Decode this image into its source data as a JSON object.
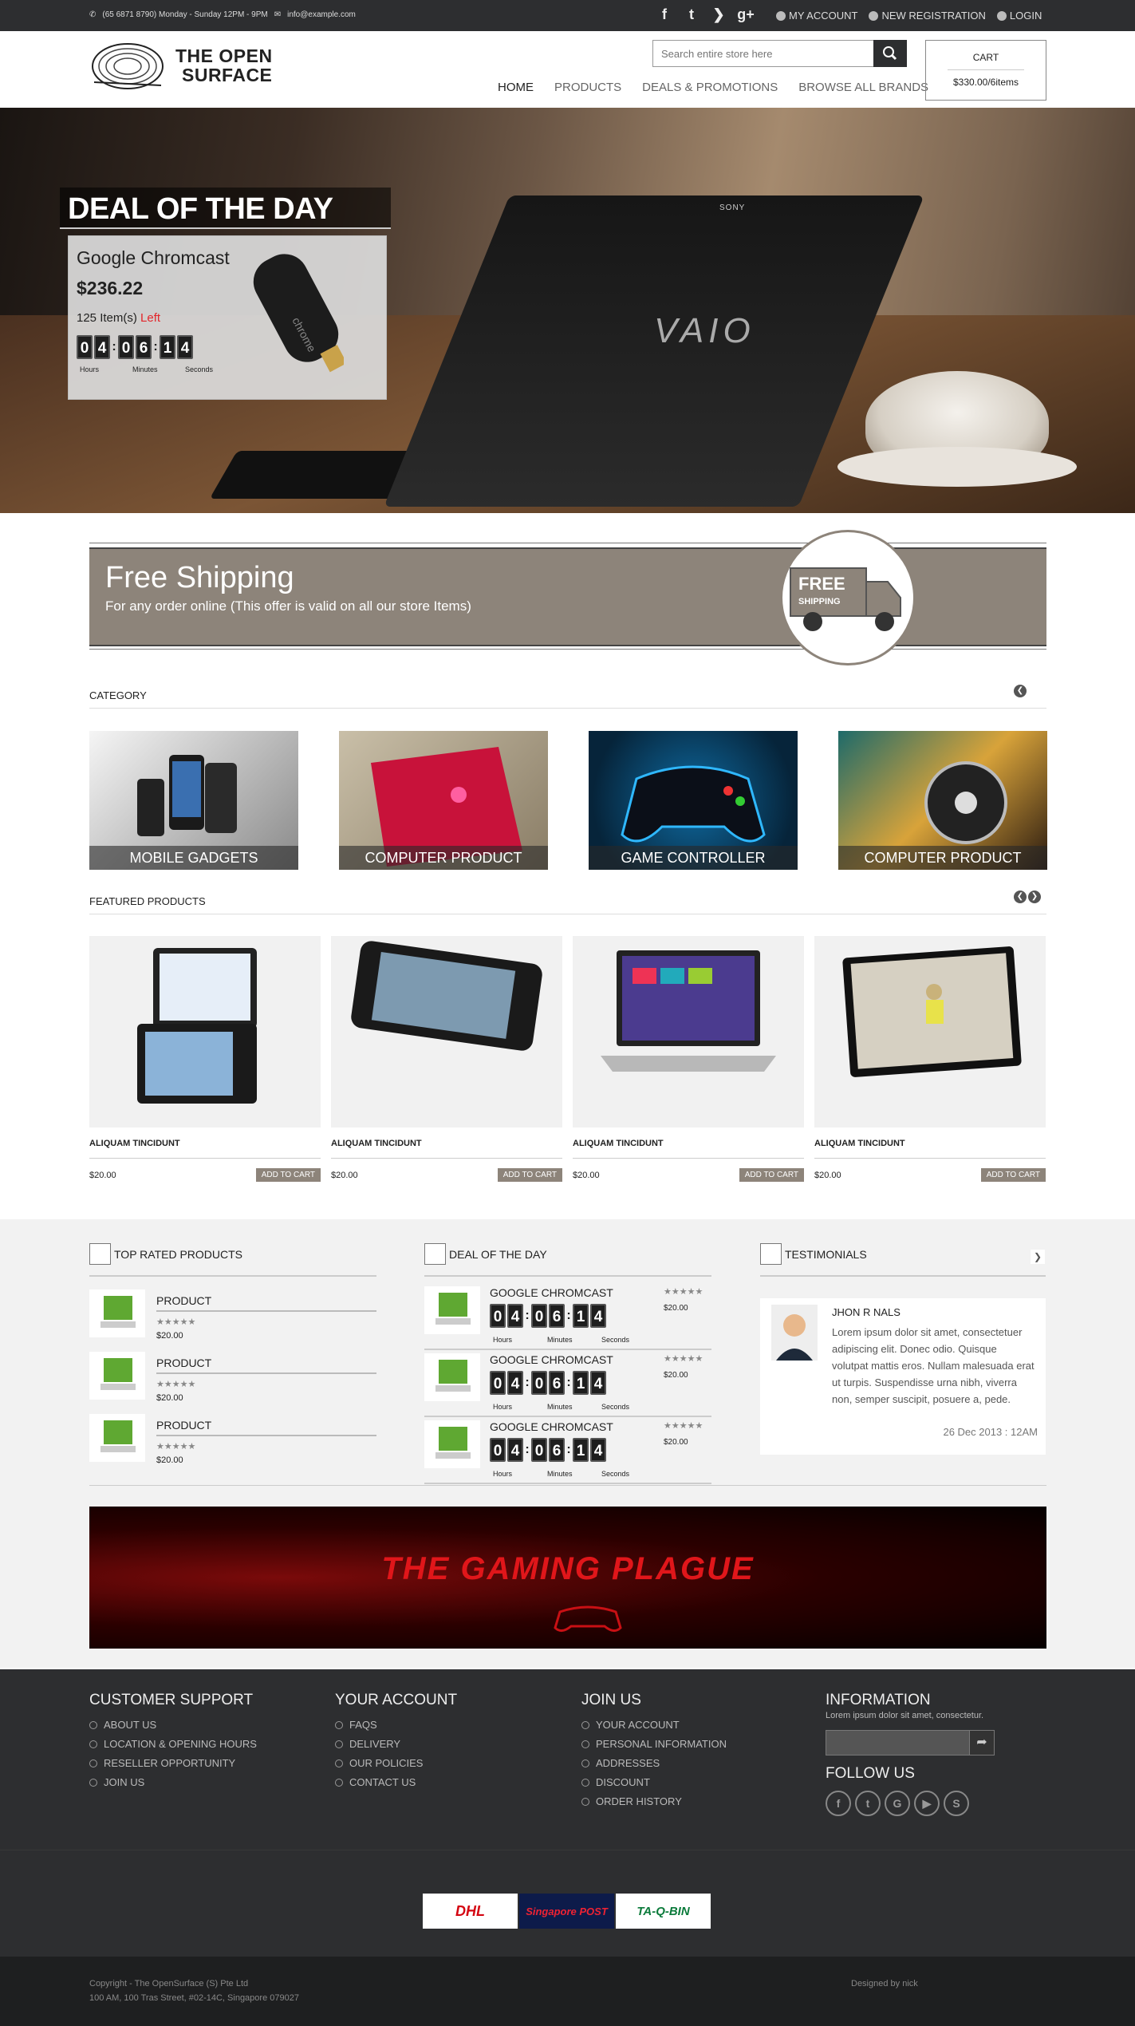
{
  "topbar": {
    "phone": "(65 6871 8790) Monday - Sunday 12PM - 9PM",
    "email": "info@example.com",
    "links": [
      "MY ACCOUNT",
      "NEW REGISTRATION",
      "LOGIN"
    ]
  },
  "header": {
    "logo_line1": "THE OPEN",
    "logo_line2": "SURFACE",
    "search_placeholder": "Search entire store here",
    "nav": [
      "HOME",
      "PRODUCTS",
      "DEALS & PROMOTIONS",
      "BROWSE ALL BRANDS"
    ],
    "cart_label": "CART",
    "cart_total": "$330.00/6items"
  },
  "hero": {
    "brand_top": "SONY",
    "brand_main": "VAIO",
    "deal_title": "DEAL OF THE DAY",
    "product": "Google Chromcast",
    "price": "$236.22",
    "items_count": "125 Item(s)",
    "items_left": "Left",
    "digits": [
      "0",
      "4",
      "0",
      "6",
      "1",
      "4"
    ],
    "labels": [
      "Hours",
      "Minutes",
      "Seconds"
    ]
  },
  "shipping": {
    "title": "Free Shipping",
    "subtitle": "For any order online (This offer is valid on all our store Items)",
    "badge1": "FREE",
    "badge2": "SHIPPING"
  },
  "category": {
    "heading": "CATEGORY",
    "items": [
      "MOBILE GADGETS",
      "COMPUTER PRODUCT",
      "GAME CONTROLLER",
      "COMPUTER PRODUCT"
    ]
  },
  "featured": {
    "heading": "FEATURED PRODUCTS",
    "items": [
      {
        "name": "ALIQUAM TINCIDUNT",
        "price": "$20.00",
        "btn": "ADD TO CART"
      },
      {
        "name": "ALIQUAM TINCIDUNT",
        "price": "$20.00",
        "btn": "ADD TO CART"
      },
      {
        "name": "ALIQUAM TINCIDUNT",
        "price": "$20.00",
        "btn": "ADD TO CART"
      },
      {
        "name": "ALIQUAM TINCIDUNT",
        "price": "$20.00",
        "btn": "ADD TO CART"
      }
    ]
  },
  "top_rated": {
    "heading": "TOP RATED PRODUCTS",
    "items": [
      {
        "name": "PRODUCT",
        "stars": "★★★★★",
        "price": "$20.00"
      },
      {
        "name": "PRODUCT",
        "stars": "★★★★★",
        "price": "$20.00"
      },
      {
        "name": "PRODUCT",
        "stars": "★★★★★",
        "price": "$20.00"
      }
    ]
  },
  "deal_list": {
    "heading": "DEAL OF THE DAY",
    "items": [
      {
        "name": "GOOGLE CHROMCAST",
        "stars": "★★★★★",
        "price": "$20.00"
      },
      {
        "name": "GOOGLE CHROMCAST",
        "stars": "★★★★★",
        "price": "$20.00"
      },
      {
        "name": "GOOGLE CHROMCAST",
        "stars": "★★★★★",
        "price": "$20.00"
      }
    ]
  },
  "testimonials": {
    "heading": "TESTIMONIALS",
    "name": "JHON R NALS",
    "text": "Lorem ipsum dolor sit amet, consectetuer adipiscing elit. Donec odio. Quisque volutpat mattis eros. Nullam malesuada erat ut turpis. Suspendisse urna nibh, viverra non, semper suscipit, posuere a, pede.",
    "date": "26 Dec 2013 : 12AM"
  },
  "banner": {
    "title": "THE GAMING PLAGUE"
  },
  "footer": {
    "customer_support": {
      "heading": "CUSTOMER SUPPORT",
      "items": [
        "ABOUT US",
        "LOCATION & OPENING HOURS",
        "RESELLER OPPORTUNITY",
        "JOIN US"
      ]
    },
    "your_account": {
      "heading": "YOUR ACCOUNT",
      "items": [
        "FAQS",
        "DELIVERY",
        "OUR POLICIES",
        "CONTACT US"
      ]
    },
    "join_us": {
      "heading": "JOIN US",
      "items": [
        "YOUR ACCOUNT",
        "PERSONAL INFORMATION",
        "ADDRESSES",
        "DISCOUNT",
        "ORDER HISTORY"
      ]
    },
    "information": {
      "heading": "INFORMATION",
      "text": "Lorem ipsum dolor sit amet, consectetur."
    },
    "follow_heading": "FOLLOW US",
    "carriers": [
      "DHL",
      "Singapore POST",
      "TA-Q-BIN"
    ],
    "copyright1": "Copyright - The OpenSurface (S) Pte Ltd",
    "copyright2": "100 AM, 100 Tras Street, #02-14C, Singapore 079027",
    "designed": "Designed by nick"
  }
}
